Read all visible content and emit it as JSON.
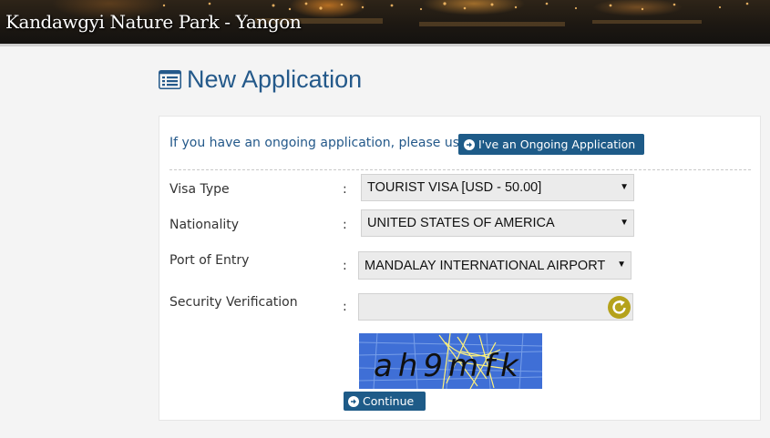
{
  "banner": {
    "title": "Kandawgyi Nature Park - Yangon"
  },
  "page": {
    "title": "New Application",
    "title_icon": "list-icon"
  },
  "ongoing": {
    "prompt": "If you have an ongoing application, please use.",
    "button_label": "I've an Ongoing Application",
    "button_icon": "circle-arrow-right-icon"
  },
  "form": {
    "colon": ":",
    "visa_type": {
      "label": "Visa Type",
      "value": "TOURIST VISA [USD - 50.00]"
    },
    "nationality": {
      "label": "Nationality",
      "value": "UNITED STATES OF AMERICA"
    },
    "port_of_entry": {
      "label": "Port of Entry",
      "value": "MANDALAY INTERNATIONAL AIRPORT"
    },
    "security": {
      "label": "Security Verification",
      "input_value": "",
      "refresh_icon": "refresh-icon",
      "captcha_text": "ah9mfk"
    },
    "continue_label": "Continue"
  },
  "colors": {
    "accent": "#1e5b88",
    "title": "#24598a",
    "refresh": "#b5a21b",
    "captcha_bg": "#3f6fd6"
  }
}
